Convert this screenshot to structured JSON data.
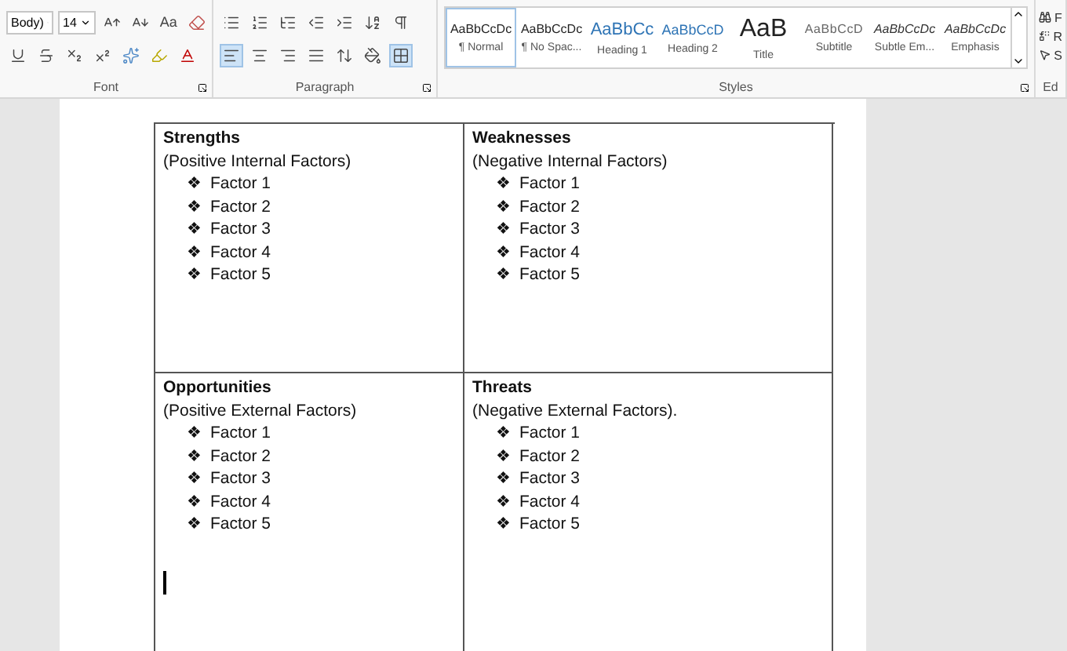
{
  "ribbon": {
    "font": {
      "name": "Body)",
      "size": "14",
      "case_label": "Aa",
      "label": "Font"
    },
    "paragraph": {
      "align": [
        {
          "kind": "left",
          "selected": true
        },
        {
          "kind": "center",
          "selected": false
        },
        {
          "kind": "right",
          "selected": false
        },
        {
          "kind": "justify",
          "selected": false
        }
      ],
      "borders_selected": true,
      "label": "Paragraph"
    },
    "styles": {
      "label": "Styles",
      "items": [
        {
          "preview": "AaBbCcDc",
          "name": "¶ Normal",
          "kind": "normal",
          "selected": true
        },
        {
          "preview": "AaBbCcDc",
          "name": "¶ No Spac...",
          "kind": "normal",
          "selected": false
        },
        {
          "preview": "AaBbCc",
          "name": "Heading 1",
          "kind": "heading1",
          "selected": false
        },
        {
          "preview": "AaBbCcD",
          "name": "Heading 2",
          "kind": "heading2",
          "selected": false
        },
        {
          "preview": "AaB",
          "name": "Title",
          "kind": "title",
          "selected": false
        },
        {
          "preview": "AaBbCcD",
          "name": "Subtitle",
          "kind": "subtitle",
          "selected": false
        },
        {
          "preview": "AaBbCcDc",
          "name": "Subtle Em...",
          "kind": "emphasis",
          "selected": false
        },
        {
          "preview": "AaBbCcDc",
          "name": "Emphasis",
          "kind": "emphasis",
          "selected": false
        }
      ]
    },
    "editing": {
      "items": [
        "F",
        "R",
        "S"
      ],
      "label": "Ed"
    }
  },
  "table": {
    "cells": [
      {
        "title": "Strengths",
        "subtitle": "(Positive Internal Factors)",
        "cursor": false,
        "factors": [
          {
            "bullet": "❖",
            "text": "Factor 1"
          },
          {
            "bullet": "❖",
            "text": "Factor 2"
          },
          {
            "bullet": "❖",
            "text": "Factor 3"
          },
          {
            "bullet": "❖",
            "text": "Factor 4"
          },
          {
            "bullet": "❖",
            "text": "Factor 5"
          }
        ]
      },
      {
        "title": "Weaknesses",
        "subtitle": "(Negative Internal Factors)",
        "cursor": false,
        "factors": [
          {
            "bullet": "❖",
            "text": "Factor 1"
          },
          {
            "bullet": "❖",
            "text": "Factor 2"
          },
          {
            "bullet": "❖",
            "text": "Factor 3"
          },
          {
            "bullet": "❖",
            "text": "Factor 4"
          },
          {
            "bullet": "❖",
            "text": "Factor 5"
          }
        ]
      },
      {
        "title": "Opportunities",
        "subtitle": "(Positive External Factors)",
        "cursor": true,
        "factors": [
          {
            "bullet": "❖",
            "text": "Factor 1"
          },
          {
            "bullet": "❖",
            "text": "Factor 2"
          },
          {
            "bullet": "❖",
            "text": "Factor 3"
          },
          {
            "bullet": "❖",
            "text": "Factor 4"
          },
          {
            "bullet": "❖",
            "text": "Factor 5"
          }
        ]
      },
      {
        "title": "Threats",
        "subtitle": "(Negative External Factors).",
        "cursor": false,
        "factors": [
          {
            "bullet": "❖",
            "text": "Factor 1"
          },
          {
            "bullet": "❖",
            "text": "Factor 2"
          },
          {
            "bullet": "❖",
            "text": "Factor 3"
          },
          {
            "bullet": "❖",
            "text": "Factor 4"
          },
          {
            "bullet": "❖",
            "text": "Factor 5"
          }
        ]
      }
    ]
  }
}
